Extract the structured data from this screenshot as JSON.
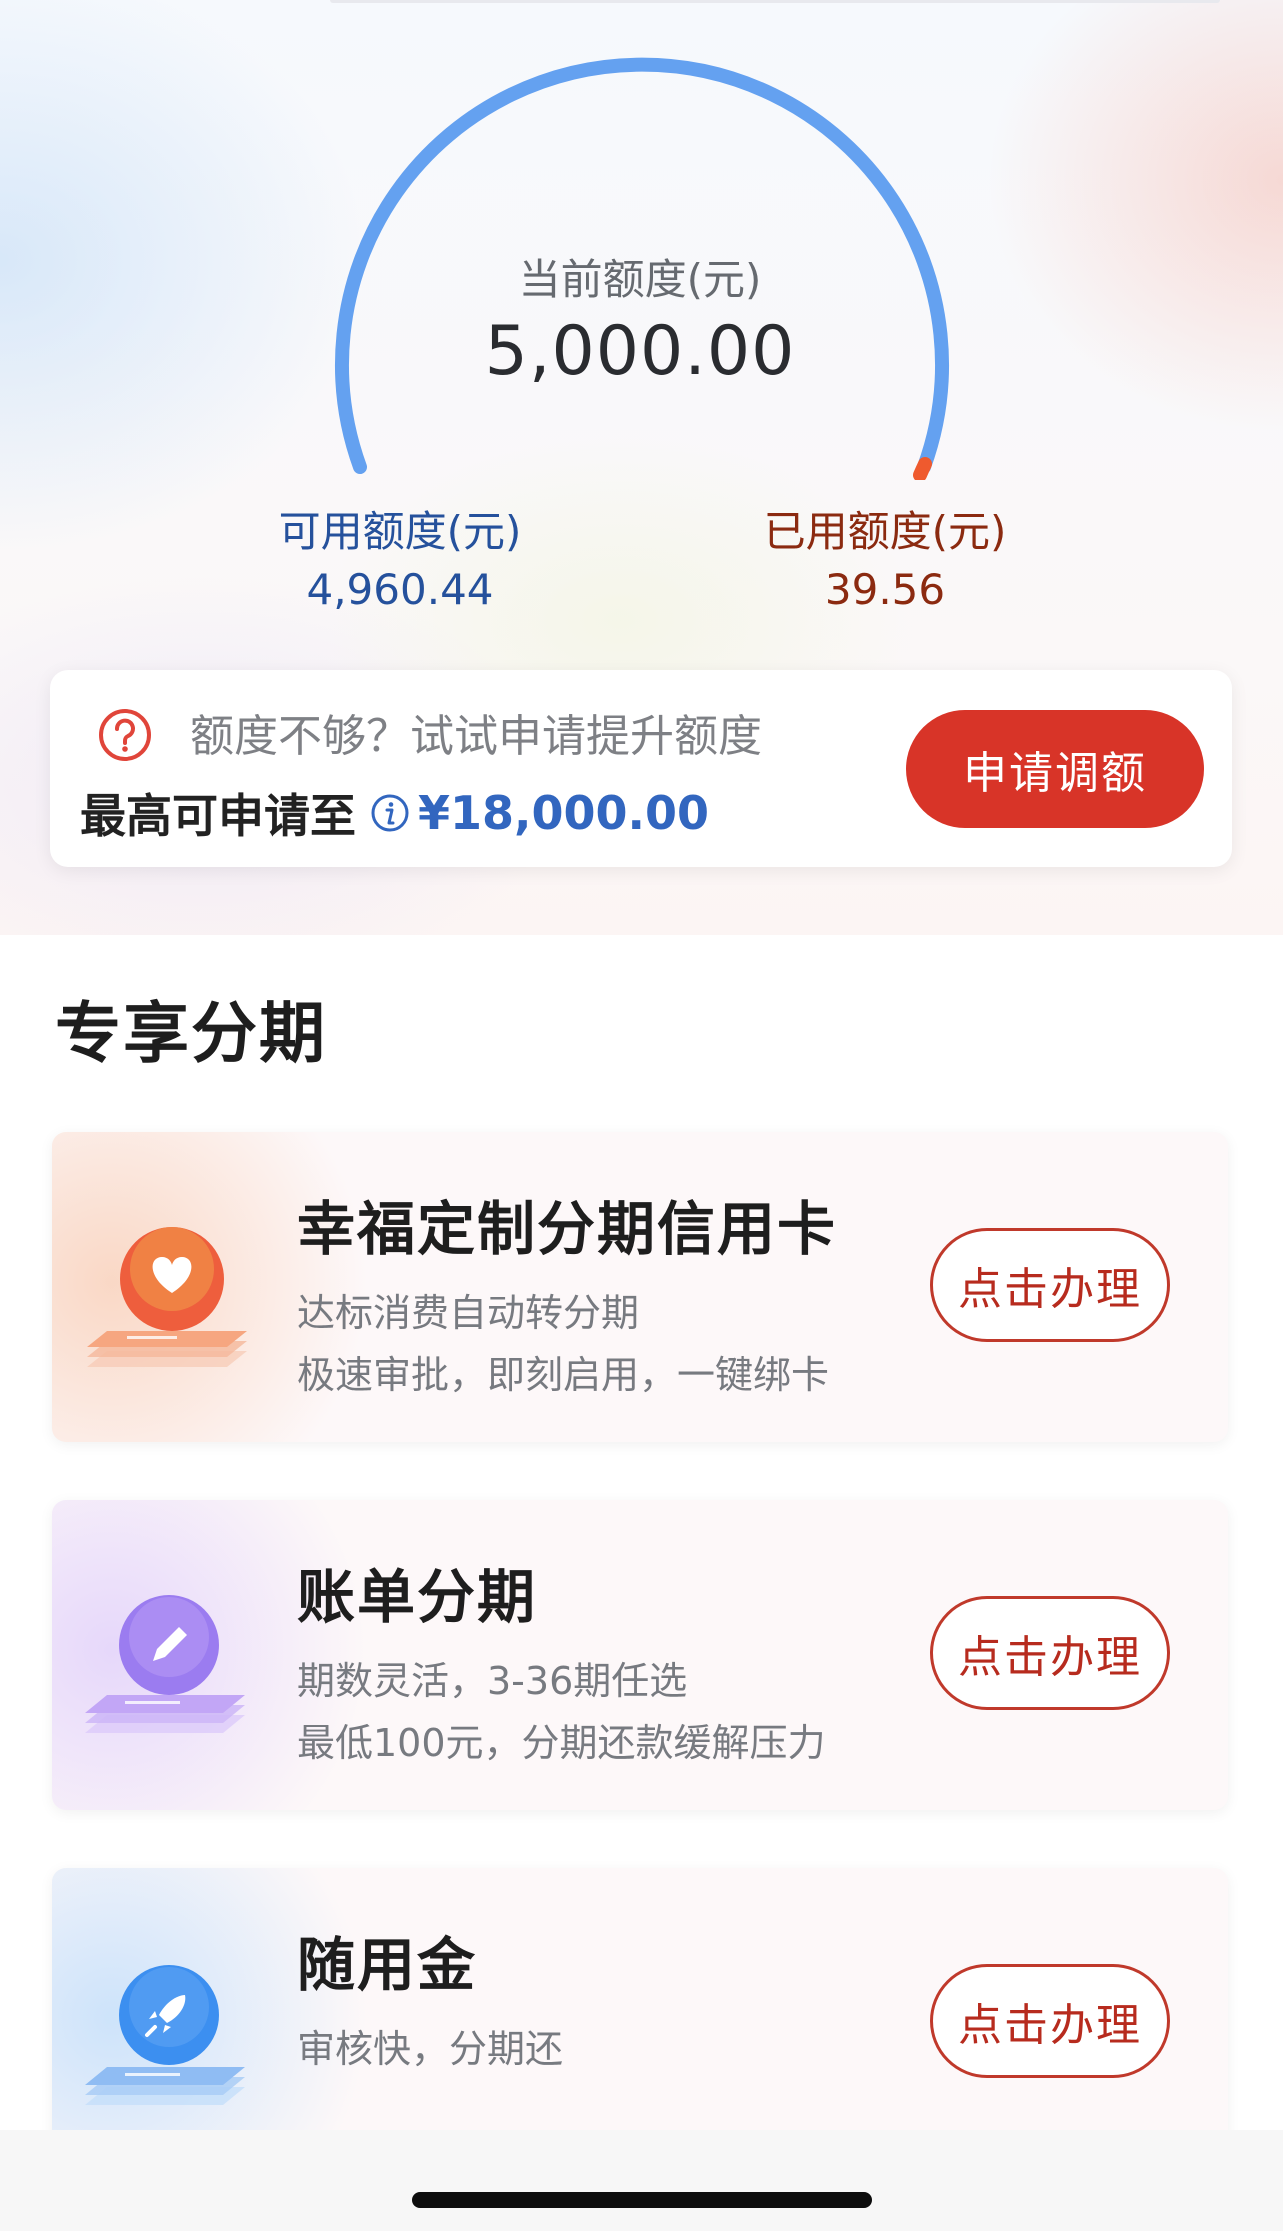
{
  "limit": {
    "current_label": "当前额度(元)",
    "current_value": "5,000.00",
    "available_label": "可用额度(元)",
    "available_value": "4,960.44",
    "used_label": "已用额度(元)",
    "used_value": "39.56",
    "gauge_used_fraction": 0.008
  },
  "upgrade": {
    "prompt": "额度不够？试试申请提升额度",
    "max_label": "最高可申请至",
    "max_amount": "¥18,000.00",
    "apply_button": "申请调额"
  },
  "section": {
    "title": "专享分期"
  },
  "products": [
    {
      "title": "幸福定制分期信用卡",
      "line1": "达标消费自动转分期",
      "line2": "极速审批，即刻启用，一键绑卡",
      "button": "点击办理",
      "icon": "heart-icon",
      "color": "#ef6a3f"
    },
    {
      "title": "账单分期",
      "line1": "期数灵活，3-36期任选",
      "line2": "最低100元，分期还款缓解压力",
      "button": "点击办理",
      "icon": "pencil-icon",
      "color": "#9b7cf0"
    },
    {
      "title": "随用金",
      "line1": "审核快，分期还",
      "button": "点击办理",
      "icon": "rocket-icon",
      "color": "#3c8ff0"
    }
  ],
  "colors": {
    "accent_red": "#d83428",
    "gauge_blue": "#64a1f0",
    "available_blue": "#25519c",
    "used_brown": "#8b2a10"
  }
}
